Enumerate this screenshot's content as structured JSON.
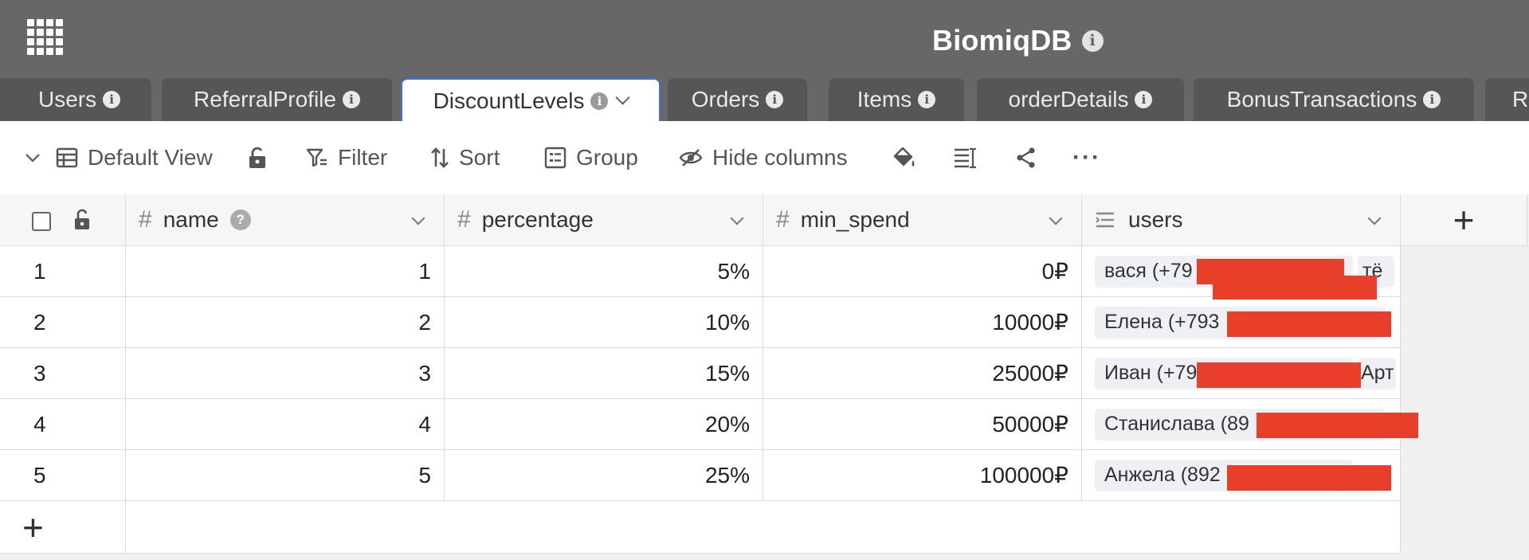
{
  "app": {
    "title": "BiomiqDB",
    "info_glyph": "i"
  },
  "tabs": [
    {
      "label": "Users"
    },
    {
      "label": "ReferralProfile"
    },
    {
      "label": "DiscountLevels",
      "active": true
    },
    {
      "label": "Orders"
    },
    {
      "label": "Items"
    },
    {
      "label": "orderDetails"
    },
    {
      "label": "BonusTransactions"
    },
    {
      "label": "Re"
    }
  ],
  "toolbar": {
    "view_label": "Default View",
    "filter_label": "Filter",
    "sort_label": "Sort",
    "group_label": "Group",
    "hide_columns_label": "Hide columns",
    "more_glyph": "···"
  },
  "table": {
    "columns": [
      {
        "name": "name",
        "icon": "hash-icon"
      },
      {
        "name": "percentage",
        "icon": "hash-icon"
      },
      {
        "name": "min_spend",
        "icon": "hash-icon"
      },
      {
        "name": "users",
        "icon": "link-list-icon"
      }
    ],
    "add_column_glyph": "+",
    "add_row_glyph": "+",
    "rows": [
      {
        "row": "1",
        "name": "1",
        "percentage": "5%",
        "min_spend": "0₽",
        "users": "вася (+79",
        "users_tail": "тё"
      },
      {
        "row": "2",
        "name": "2",
        "percentage": "10%",
        "min_spend": "10000₽",
        "users": "Елена (+793",
        "users_tail": ""
      },
      {
        "row": "3",
        "name": "3",
        "percentage": "15%",
        "min_spend": "25000₽",
        "users": "Иван (+79",
        "users_tail": "Арт"
      },
      {
        "row": "4",
        "name": "4",
        "percentage": "20%",
        "min_spend": "50000₽",
        "users": "Станислава (89",
        "users_tail": ""
      },
      {
        "row": "5",
        "name": "5",
        "percentage": "25%",
        "min_spend": "100000₽",
        "users": "Анжела (892",
        "users_tail": ""
      }
    ]
  },
  "colors": {
    "topbar": "#676767",
    "tab_inactive": "#565656",
    "active_tab_border": "#3f6fd8",
    "redaction": "#e83f2b"
  }
}
